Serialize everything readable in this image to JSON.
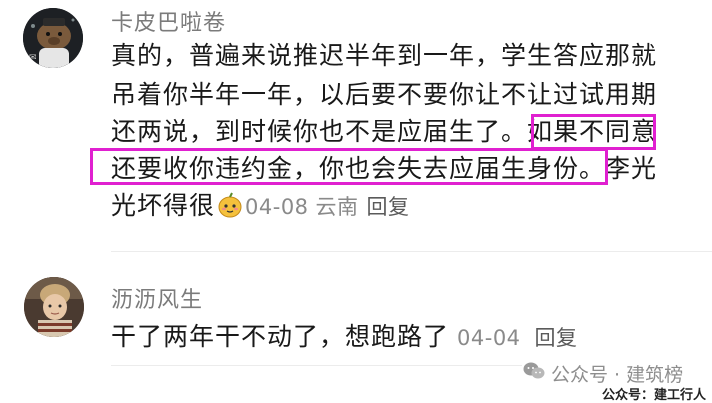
{
  "comments": [
    {
      "username": "卡皮巴啦卷",
      "lines": [
        "真的，普遍来说推迟半年到一年，学生答应那就",
        "吊着你半年一年，以后要不要你让不让过试用期",
        "还两说，到时候你也不是应届生了。如果不同意",
        "还要收你违约金，你也会失去应届生身份。李光",
        "光坏得很"
      ],
      "date": "04-08",
      "location": "云南",
      "reply_label": "回复",
      "emoji": "pear-face-emoji"
    },
    {
      "username": "沥沥风生",
      "lines": [
        "干了两年干不动了，想跑路了"
      ],
      "date": "04-04",
      "reply_label": "回复"
    }
  ],
  "watermark": {
    "main": "公众号 · 建筑榜",
    "sub": "公众号：建工行人"
  },
  "colors": {
    "highlight": "#e020d0",
    "meta": "#8a8a8a",
    "username": "#7b7b7b"
  }
}
